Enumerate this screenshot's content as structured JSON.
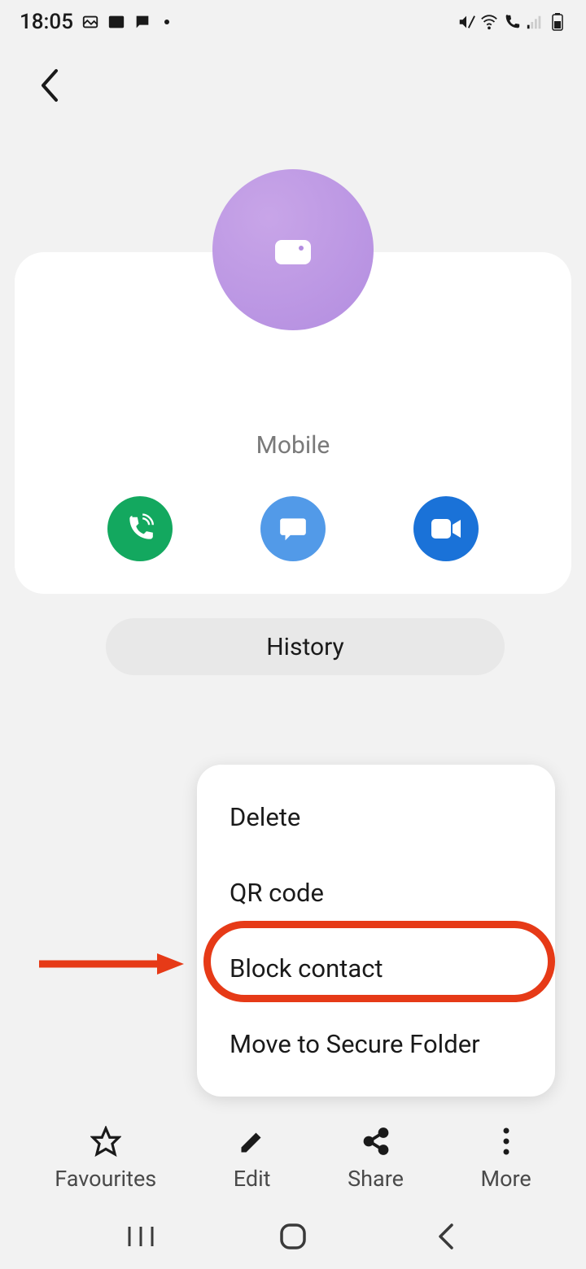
{
  "status": {
    "time": "18:05"
  },
  "contact": {
    "phone_label": "Mobile"
  },
  "history_btn": "History",
  "menu": {
    "items": [
      {
        "label": "Delete"
      },
      {
        "label": "QR code"
      },
      {
        "label": "Block contact"
      },
      {
        "label": "Move to Secure Folder"
      }
    ]
  },
  "bottom": {
    "favourites": "Favourites",
    "edit": "Edit",
    "share": "Share",
    "more": "More"
  }
}
